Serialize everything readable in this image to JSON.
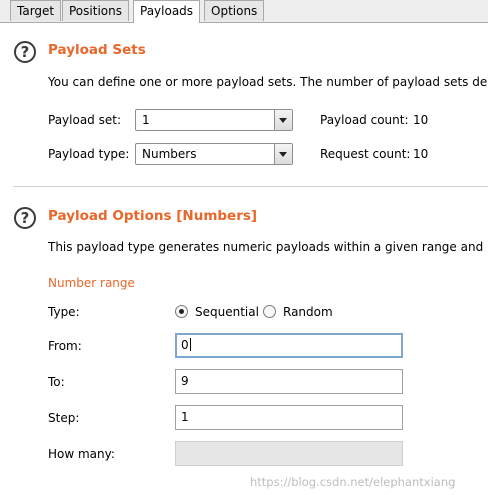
{
  "tabs": [
    {
      "label": "Target"
    },
    {
      "label": "Positions"
    },
    {
      "label": "Payloads",
      "active": true
    },
    {
      "label": "Options"
    }
  ],
  "payload_sets": {
    "title": "Payload Sets",
    "description": "You can define one or more payload sets. The number of payload sets depen",
    "set_label": "Payload set:",
    "set_value": "1",
    "type_label": "Payload type:",
    "type_value": "Numbers",
    "count_label": "Payload count:",
    "count_value": "10",
    "request_label": "Request count:",
    "request_value": "10"
  },
  "payload_options": {
    "title": "Payload Options [Numbers]",
    "description": "This payload type generates numeric payloads within a given range and in a",
    "number_range_label": "Number range",
    "type_label": "Type:",
    "sequential_label": "Sequential",
    "random_label": "Random",
    "selected_type": "Sequential",
    "from_label": "From:",
    "from_value": "0",
    "to_label": "To:",
    "to_value": "9",
    "step_label": "Step:",
    "step_value": "1",
    "how_many_label": "How many:",
    "how_many_value": ""
  },
  "watermark": "https://blog.csdn.net/elephantxiang",
  "colors": {
    "accent": "#e8672b",
    "focus_border": "#7ea6cf"
  },
  "icons": {
    "help": "help-circle-icon",
    "dropdown": "chevron-down-icon"
  }
}
